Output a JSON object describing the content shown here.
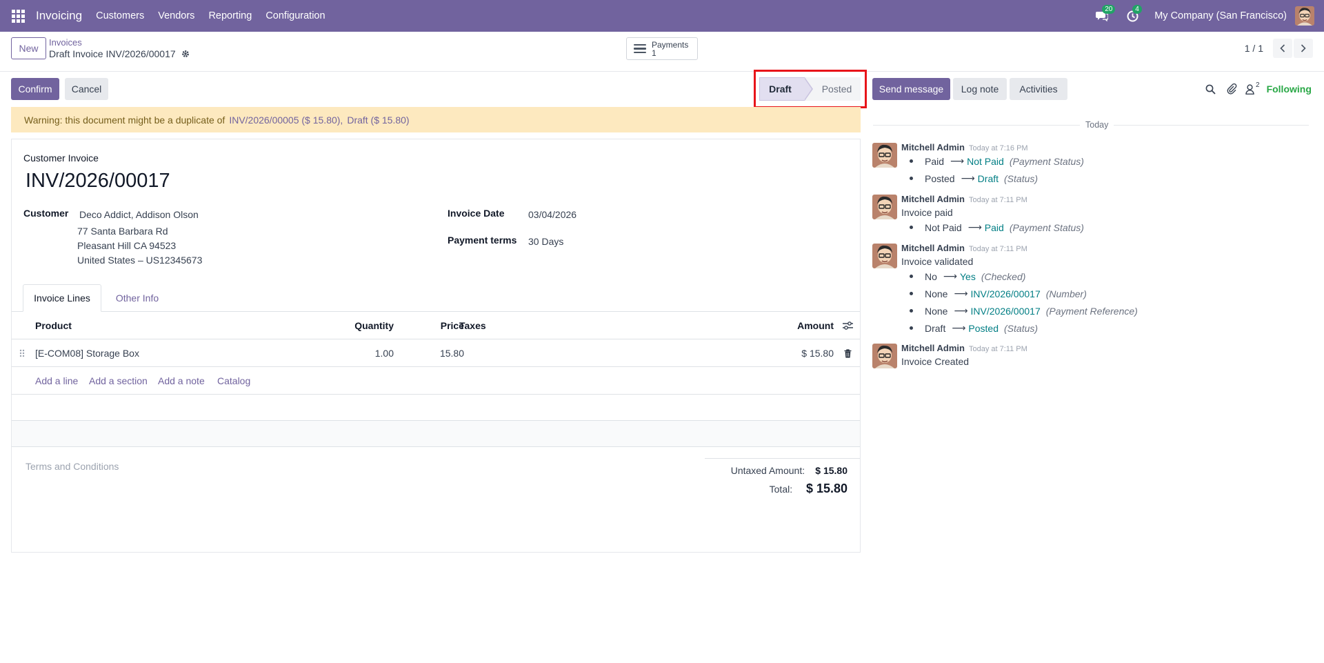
{
  "navbar": {
    "app_name": "Invoicing",
    "menu": [
      "Customers",
      "Vendors",
      "Reporting",
      "Configuration"
    ],
    "messages_count": "20",
    "activities_count": "4",
    "company": "My Company (San Francisco)"
  },
  "control_panel": {
    "new_label": "New",
    "breadcrumb_parent": "Invoices",
    "breadcrumb_current": "Draft Invoice INV/2026/00017",
    "payments_label": "Payments",
    "payments_count": "1",
    "pager_value": "1 / 1"
  },
  "actions": {
    "confirm": "Confirm",
    "cancel": "Cancel"
  },
  "status": {
    "stages": [
      "Draft",
      "Posted"
    ],
    "current": "Draft"
  },
  "warning": {
    "text": "Warning: this document might be a duplicate of",
    "links": [
      "INV/2026/00005 ($ 15.80),",
      "Draft ($ 15.80)"
    ]
  },
  "invoice": {
    "type_label": "Customer Invoice",
    "number": "INV/2026/00017",
    "customer_label": "Customer",
    "customer_name": "Deco Addict, Addison Olson",
    "address_line1": "77 Santa Barbara Rd",
    "address_line2": "Pleasant Hill CA 94523",
    "address_line3": "United States – US12345673",
    "date_label": "Invoice Date",
    "date_value": "03/04/2026",
    "terms_label": "Payment terms",
    "terms_value": "30 Days"
  },
  "tabs": [
    "Invoice Lines",
    "Other Info"
  ],
  "lines": {
    "headers": {
      "product": "Product",
      "quantity": "Quantity",
      "price": "Price",
      "taxes": "Taxes",
      "amount": "Amount"
    },
    "rows": [
      {
        "product": "[E-COM08] Storage Box",
        "quantity": "1.00",
        "price": "15.80",
        "taxes": "",
        "amount": "$ 15.80"
      }
    ],
    "add_links": [
      "Add a line",
      "Add a section",
      "Add a note",
      "Catalog"
    ]
  },
  "terms_placeholder": "Terms and Conditions",
  "totals": {
    "untaxed_label": "Untaxed Amount:",
    "untaxed_value": "$ 15.80",
    "total_label": "Total:",
    "total_value": "$ 15.80"
  },
  "chatter": {
    "send_message": "Send message",
    "log_note": "Log note",
    "activities": "Activities",
    "followers_count": "2",
    "following": "Following",
    "date_separator": "Today",
    "messages": [
      {
        "author": "Mitchell Admin",
        "time": "Today at 7:16 PM",
        "body": "",
        "tracking": [
          {
            "old": "Paid",
            "new": "Not Paid",
            "field": "(Payment Status)"
          },
          {
            "old": "Posted",
            "new": "Draft",
            "field": "(Status)"
          }
        ]
      },
      {
        "author": "Mitchell Admin",
        "time": "Today at 7:11 PM",
        "body": "Invoice paid",
        "tracking": [
          {
            "old": "Not Paid",
            "new": "Paid",
            "field": "(Payment Status)"
          }
        ]
      },
      {
        "author": "Mitchell Admin",
        "time": "Today at 7:11 PM",
        "body": "Invoice validated",
        "tracking": [
          {
            "old": "No",
            "new": "Yes",
            "field": "(Checked)"
          },
          {
            "old": "None",
            "new": "INV/2026/00017",
            "field": "(Number)"
          },
          {
            "old": "None",
            "new": "INV/2026/00017",
            "field": "(Payment Reference)"
          },
          {
            "old": "Draft",
            "new": "Posted",
            "field": "(Status)"
          }
        ]
      },
      {
        "author": "Mitchell Admin",
        "time": "Today at 7:11 PM",
        "body": "Invoice Created",
        "tracking": []
      }
    ]
  },
  "colors": {
    "brand": "#71639e",
    "warning_bg": "#fde9bf",
    "tracking_new": "#017e84",
    "following": "#28a745",
    "highlight": "#e8141a"
  }
}
